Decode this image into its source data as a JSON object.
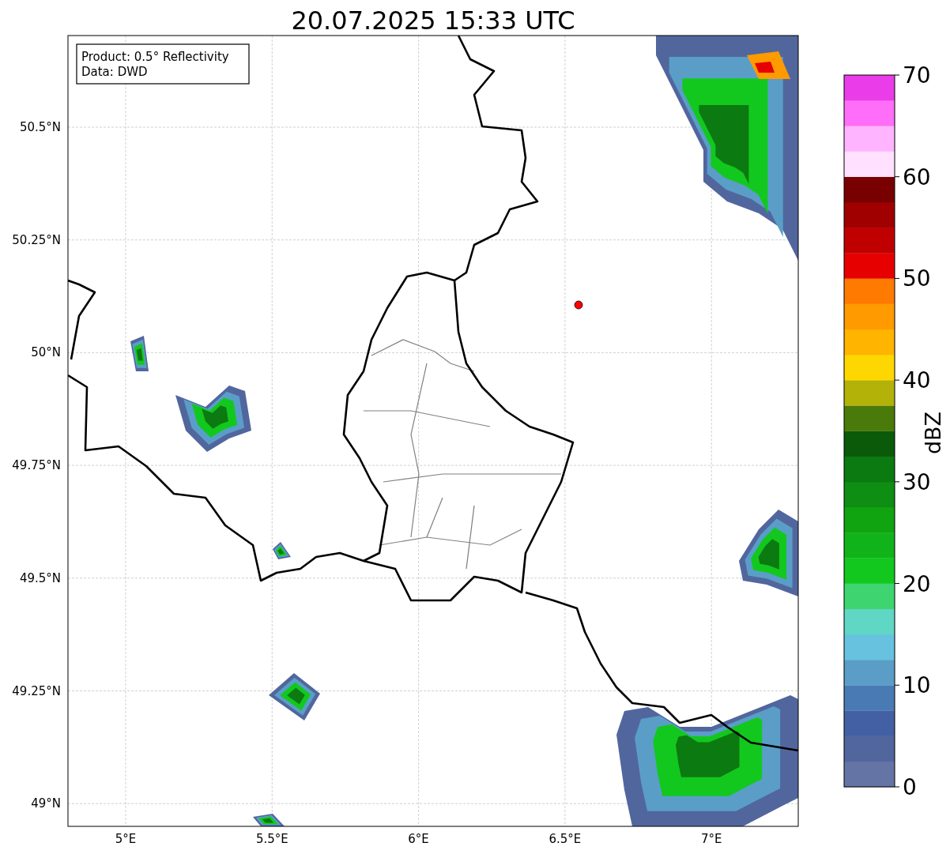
{
  "title": "20.07.2025 15:33 UTC",
  "info_box": {
    "lines": [
      "Product: 0.5° Reflectivity",
      "Data: DWD"
    ]
  },
  "y_ticks": [
    "50.5°N",
    "50.25°N",
    "50°N",
    "49.75°N",
    "49.5°N",
    "49.25°N",
    "49°N"
  ],
  "x_ticks": [
    "5°E",
    "5.5°E",
    "6°E",
    "6.5°E",
    "7°E"
  ],
  "colorbar": {
    "label": "dBZ",
    "ticks": [
      "70",
      "60",
      "50",
      "40",
      "30",
      "20",
      "10",
      "0"
    ],
    "bands": [
      {
        "color": "#6474a4"
      },
      {
        "color": "#52669e"
      },
      {
        "color": "#4460a4"
      },
      {
        "color": "#4a7ab4"
      },
      {
        "color": "#5a9ec8"
      },
      {
        "color": "#66c2de"
      },
      {
        "color": "#60d6c4"
      },
      {
        "color": "#3ed570"
      },
      {
        "color": "#12c81e"
      },
      {
        "color": "#10b41a"
      },
      {
        "color": "#10a410"
      },
      {
        "color": "#0e8e12"
      },
      {
        "color": "#0b7a10"
      },
      {
        "color": "#0a5a0a"
      },
      {
        "color": "#4a7a0a"
      },
      {
        "color": "#b2b208"
      },
      {
        "color": "#ffd700"
      },
      {
        "color": "#ffb400"
      },
      {
        "color": "#ff9a00"
      },
      {
        "color": "#ff7a00"
      },
      {
        "color": "#e60000"
      },
      {
        "color": "#c00000"
      },
      {
        "color": "#a00000"
      },
      {
        "color": "#780000"
      },
      {
        "color": "#ffe0ff"
      },
      {
        "color": "#ffb4ff"
      },
      {
        "color": "#ff6ef8"
      },
      {
        "color": "#ea3ce8"
      }
    ]
  }
}
